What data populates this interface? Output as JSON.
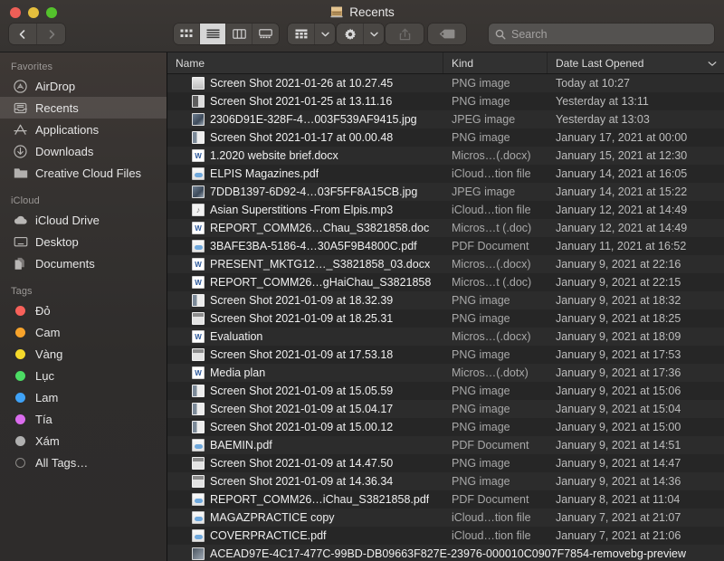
{
  "window": {
    "title": "Recents",
    "title_icon": "recents-clock-icon",
    "traffic_lights": [
      {
        "name": "close",
        "color": "#ee5f57"
      },
      {
        "name": "minimize",
        "color": "#e5bf3d"
      },
      {
        "name": "zoom",
        "color": "#54c22c"
      }
    ]
  },
  "toolbar": {
    "back_label": "Back",
    "forward_label": "Forward",
    "view_modes": [
      {
        "name": "icon-view",
        "label": "Icon View",
        "active": false
      },
      {
        "name": "list-view",
        "label": "List View",
        "active": true
      },
      {
        "name": "column-view",
        "label": "Column View",
        "active": false
      },
      {
        "name": "gallery-view",
        "label": "Gallery View",
        "active": false
      }
    ],
    "group_label": "Group By",
    "action_label": "Action",
    "share_label": "Share",
    "tag_label": "Tags"
  },
  "search": {
    "placeholder": "Search",
    "value": ""
  },
  "sidebar": {
    "sections": [
      {
        "title": "Favorites",
        "items": [
          {
            "label": "AirDrop",
            "icon": "airdrop-icon",
            "selected": false
          },
          {
            "label": "Recents",
            "icon": "recents-icon",
            "selected": true
          },
          {
            "label": "Applications",
            "icon": "applications-icon",
            "selected": false
          },
          {
            "label": "Downloads",
            "icon": "downloads-icon",
            "selected": false
          },
          {
            "label": "Creative Cloud Files",
            "icon": "folder-icon",
            "selected": false
          }
        ]
      },
      {
        "title": "iCloud",
        "items": [
          {
            "label": "iCloud Drive",
            "icon": "cloud-icon",
            "selected": false
          },
          {
            "label": "Desktop",
            "icon": "desktop-icon",
            "selected": false
          },
          {
            "label": "Documents",
            "icon": "documents-icon",
            "selected": false
          }
        ]
      },
      {
        "title": "Tags",
        "items": [
          {
            "label": "Đỏ",
            "icon": "tag-dot-icon",
            "color": "#f8615a",
            "selected": false
          },
          {
            "label": "Cam",
            "icon": "tag-dot-icon",
            "color": "#f7a32b",
            "selected": false
          },
          {
            "label": "Vàng",
            "icon": "tag-dot-icon",
            "color": "#f5d92b",
            "selected": false
          },
          {
            "label": "Lục",
            "icon": "tag-dot-icon",
            "color": "#4cdc64",
            "selected": false
          },
          {
            "label": "Lam",
            "icon": "tag-dot-icon",
            "color": "#3fa2f7",
            "selected": false
          },
          {
            "label": "Tía",
            "icon": "tag-dot-icon",
            "color": "#d munkaf",
            "selected": false
          },
          {
            "label": "Xám",
            "icon": "tag-dot-icon",
            "color": "#b0b0b0",
            "selected": false
          },
          {
            "label": "All Tags…",
            "icon": "all-tags-icon",
            "color": "ring",
            "selected": false
          }
        ]
      }
    ]
  },
  "file_list": {
    "columns": [
      {
        "key": "name",
        "label": "Name"
      },
      {
        "key": "kind",
        "label": "Kind"
      },
      {
        "key": "date",
        "label": "Date Last Opened",
        "sorted": true,
        "sort_dir": "desc"
      }
    ],
    "rows": [
      {
        "name": "Screen Shot 2021-01-26 at 10.27.45",
        "kind": "PNG image",
        "date": "Today at 10:27",
        "icon": "ico-shot"
      },
      {
        "name": "Screen Shot 2021-01-25 at 13.11.16",
        "kind": "PNG image",
        "date": "Yesterday at 13:11",
        "icon": "ico-png2"
      },
      {
        "name": "2306D91E-328F-4…003F539AF9415.jpg",
        "kind": "JPEG image",
        "date": "Yesterday at 13:03",
        "icon": "ico-jpg"
      },
      {
        "name": "Screen Shot 2021-01-17 at 00.00.48",
        "kind": "PNG image",
        "date": "January 17, 2021 at 00:00",
        "icon": "ico-shot-c"
      },
      {
        "name": "1.2020 website brief.docx",
        "kind": "Micros…(.docx)",
        "date": "January 15, 2021 at 12:30",
        "icon": "ico-doc"
      },
      {
        "name": "ELPIS Magazines.pdf",
        "kind": "iCloud…tion file",
        "date": "January 14, 2021 at 16:05",
        "icon": "ico-cloud"
      },
      {
        "name": "7DDB1397-6D92-4…03F5FF8A15CB.jpg",
        "kind": "JPEG image",
        "date": "January 14, 2021 at 15:22",
        "icon": "ico-jpg"
      },
      {
        "name": "Asian Superstitions -From Elpis.mp3",
        "kind": "iCloud…tion file",
        "date": "January 12, 2021 at 14:49",
        "icon": "ico-mp3"
      },
      {
        "name": "REPORT_COMM26…Chau_S3821858.doc",
        "kind": "Micros…t (.doc)",
        "date": "January 12, 2021 at 14:49",
        "icon": "ico-doc"
      },
      {
        "name": "3BAFE3BA-5186-4…30A5F9B4800C.pdf",
        "kind": "PDF Document",
        "date": "January 11, 2021 at 16:52",
        "icon": "ico-cloud"
      },
      {
        "name": "PRESENT_MKTG12…_S3821858_03.docx",
        "kind": "Micros…(.docx)",
        "date": "January 9, 2021 at 22:16",
        "icon": "ico-doc"
      },
      {
        "name": "REPORT_COMM26…gHaiChau_S3821858",
        "kind": "Micros…t (.doc)",
        "date": "January 9, 2021 at 22:15",
        "icon": "ico-doc"
      },
      {
        "name": "Screen Shot 2021-01-09 at 18.32.39",
        "kind": "PNG image",
        "date": "January 9, 2021 at 18:32",
        "icon": "ico-shot-c"
      },
      {
        "name": "Screen Shot 2021-01-09 at 18.25.31",
        "kind": "PNG image",
        "date": "January 9, 2021 at 18:25",
        "icon": "ico-shot-b"
      },
      {
        "name": "Evaluation",
        "kind": "Micros…(.docx)",
        "date": "January 9, 2021 at 18:09",
        "icon": "ico-doc"
      },
      {
        "name": "Screen Shot 2021-01-09 at 17.53.18",
        "kind": "PNG image",
        "date": "January 9, 2021 at 17:53",
        "icon": "ico-shot-b"
      },
      {
        "name": "Media plan",
        "kind": "Micros…(.dotx)",
        "date": "January 9, 2021 at 17:36",
        "icon": "ico-doc"
      },
      {
        "name": "Screen Shot 2021-01-09 at 15.05.59",
        "kind": "PNG image",
        "date": "January 9, 2021 at 15:06",
        "icon": "ico-shot-c"
      },
      {
        "name": "Screen Shot 2021-01-09 at 15.04.17",
        "kind": "PNG image",
        "date": "January 9, 2021 at 15:04",
        "icon": "ico-shot-c"
      },
      {
        "name": "Screen Shot 2021-01-09 at 15.00.12",
        "kind": "PNG image",
        "date": "January 9, 2021 at 15:00",
        "icon": "ico-shot-c"
      },
      {
        "name": "BAEMIN.pdf",
        "kind": "PDF Document",
        "date": "January 9, 2021 at 14:51",
        "icon": "ico-cloud"
      },
      {
        "name": "Screen Shot 2021-01-09 at 14.47.50",
        "kind": "PNG image",
        "date": "January 9, 2021 at 14:47",
        "icon": "ico-shot-b"
      },
      {
        "name": "Screen Shot 2021-01-09 at 14.36.34",
        "kind": "PNG image",
        "date": "January 9, 2021 at 14:36",
        "icon": "ico-shot-b"
      },
      {
        "name": "REPORT_COMM26…iChau_S3821858.pdf",
        "kind": "PDF Document",
        "date": "January 8, 2021 at 11:04",
        "icon": "ico-cloud"
      },
      {
        "name": "MAGAZPRACTICE copy",
        "kind": "iCloud…tion file",
        "date": "January 7, 2021 at 21:07",
        "icon": "ico-cloud"
      },
      {
        "name": "COVERPRACTICE.pdf",
        "kind": "iCloud…tion file",
        "date": "January 7, 2021 at 21:06",
        "icon": "ico-cloud"
      },
      {
        "name": "ACEAD97E-4C17-477C-99BD-DB09663F827E-23976-000010C0907F7854-removebg-preview",
        "kind": "",
        "date": "",
        "icon": "ico-rbg",
        "full_width": true
      }
    ]
  }
}
